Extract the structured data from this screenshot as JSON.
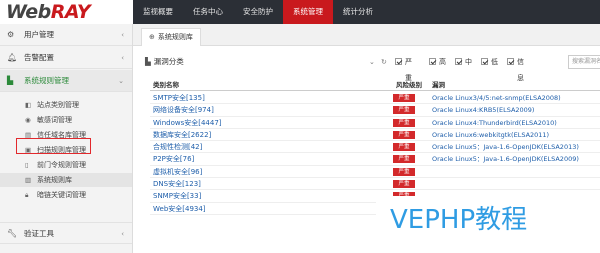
{
  "logo": {
    "web": "Web",
    "ray": "RAY"
  },
  "topnav": [
    "监视概要",
    "任务中心",
    "安全防护",
    "系统管理",
    "统计分析"
  ],
  "sidebar": {
    "sections": [
      {
        "icon": "gear-icon",
        "label": "用户管理"
      },
      {
        "icon": "bell-icon",
        "label": "告警配置"
      },
      {
        "icon": "sitemap-icon",
        "label": "系统规则管理"
      },
      {
        "icon": "wrench-icon",
        "label": "验证工具"
      }
    ],
    "items": [
      {
        "icon": "shield-icon",
        "label": "站点类别管理"
      },
      {
        "icon": "eye-icon",
        "label": "敏感词管理"
      },
      {
        "icon": "file-icon",
        "label": "信任域名库管理"
      },
      {
        "icon": "scan-icon",
        "label": "扫描规则库管理"
      },
      {
        "icon": "door-icon",
        "label": "前门令规则管理"
      },
      {
        "icon": "book-icon",
        "label": "系统规则库"
      },
      {
        "icon": "lock-icon",
        "label": "暗链关键词管理"
      }
    ]
  },
  "tab": {
    "label": "系统规则库"
  },
  "panel": {
    "title": "漏洞分类",
    "search_placeholder": "搜索漏洞名"
  },
  "filters": [
    "严重",
    "高",
    "中",
    "低",
    "信息"
  ],
  "table": {
    "headers": [
      "类别名称",
      "风险级别",
      "漏洞"
    ],
    "level_label": "严重",
    "rows": [
      {
        "name": "SMTP安全[135]",
        "vuln": "Oracle Linux3/4/5:net-snmp(ELSA2008)"
      },
      {
        "name": "网络设备安全[974]",
        "vuln": "Oracle Linux4:KRB5(ELSA2009)"
      },
      {
        "name": "Windows安全[4447]",
        "vuln": "Oracle Linux4:Thunderbird(ELSA2010)"
      },
      {
        "name": "数据库安全[2622]",
        "vuln": "Oracle Linux6:webkitgtk(ELSA2011)"
      },
      {
        "name": "合规性检测[42]",
        "vuln": "Oracle Linux5：Java-1.6-OpenJDK(ELSA2013)"
      },
      {
        "name": "P2P安全[76]",
        "vuln": "Oracle Linux5：Java-1.6-OpenJDK(ELSA2009)"
      },
      {
        "name": "虚拟机安全[96]",
        "vuln": ""
      },
      {
        "name": "DNS安全[123]",
        "vuln": ""
      },
      {
        "name": "SNMP安全[33]",
        "vuln": ""
      },
      {
        "name": "Web安全[4934]",
        "vuln": ""
      }
    ]
  },
  "watermark": "VEPHP教程"
}
